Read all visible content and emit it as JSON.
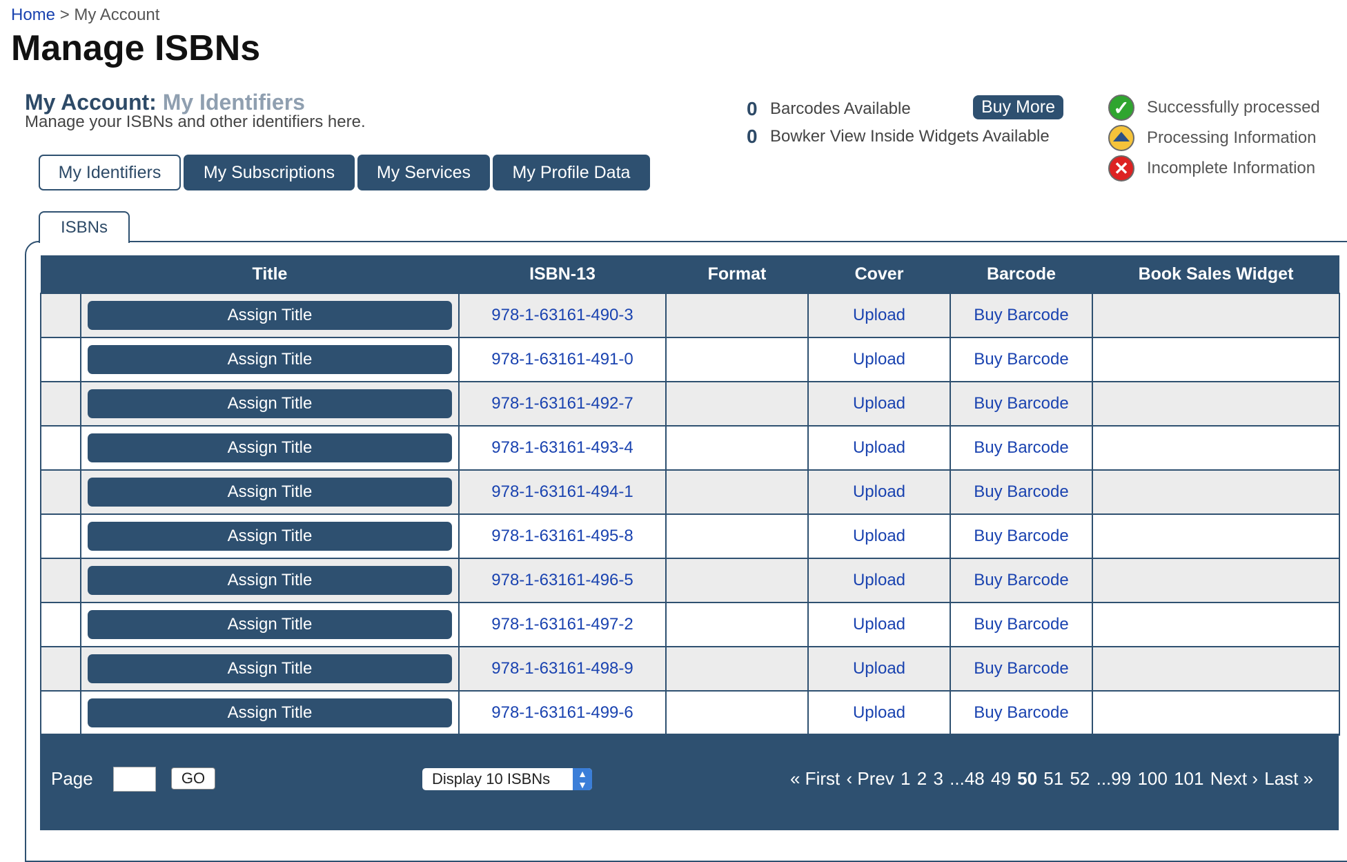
{
  "breadcrumb": {
    "home": "Home",
    "sep": ">",
    "current": "My Account"
  },
  "page_title": "Manage ISBNs",
  "account": {
    "label": "My Account:",
    "section": "My Identifiers",
    "description": "Manage your ISBNs and other identifiers here."
  },
  "stats": [
    {
      "count": "0",
      "label": "Barcodes Available"
    },
    {
      "count": "0",
      "label": "Bowker View Inside Widgets Available"
    }
  ],
  "buy_more": "Buy More",
  "legend": [
    {
      "icon": "check-icon",
      "label": "Successfully processed"
    },
    {
      "icon": "processing-icon",
      "label": "Processing Information"
    },
    {
      "icon": "x-icon",
      "label": "Incomplete Information"
    }
  ],
  "tabs": [
    "My Identifiers",
    "My Subscriptions",
    "My Services",
    "My Profile Data"
  ],
  "subtab": "ISBNs",
  "table": {
    "headers": [
      "",
      "Title",
      "ISBN-13",
      "Format",
      "Cover",
      "Barcode",
      "Book Sales Widget"
    ],
    "assign_label": "Assign Title",
    "upload_label": "Upload",
    "barcode_label": "Buy Barcode",
    "rows": [
      "978-1-63161-490-3",
      "978-1-63161-491-0",
      "978-1-63161-492-7",
      "978-1-63161-493-4",
      "978-1-63161-494-1",
      "978-1-63161-495-8",
      "978-1-63161-496-5",
      "978-1-63161-497-2",
      "978-1-63161-498-9",
      "978-1-63161-499-6"
    ]
  },
  "pager": {
    "page_label": "Page",
    "go_label": "GO",
    "display_select": "Display 10 ISBNs",
    "first": "« First",
    "prev": "‹ Prev",
    "pages": [
      "1",
      "2",
      "3",
      "...48",
      "49",
      "50",
      "51",
      "52",
      "...99",
      "100",
      "101"
    ],
    "current_page": "50",
    "next": "Next ›",
    "last": "Last »"
  },
  "colors": {
    "navy": "#2e5070",
    "link": "#1a43b0",
    "row_alt": "#ececec"
  }
}
